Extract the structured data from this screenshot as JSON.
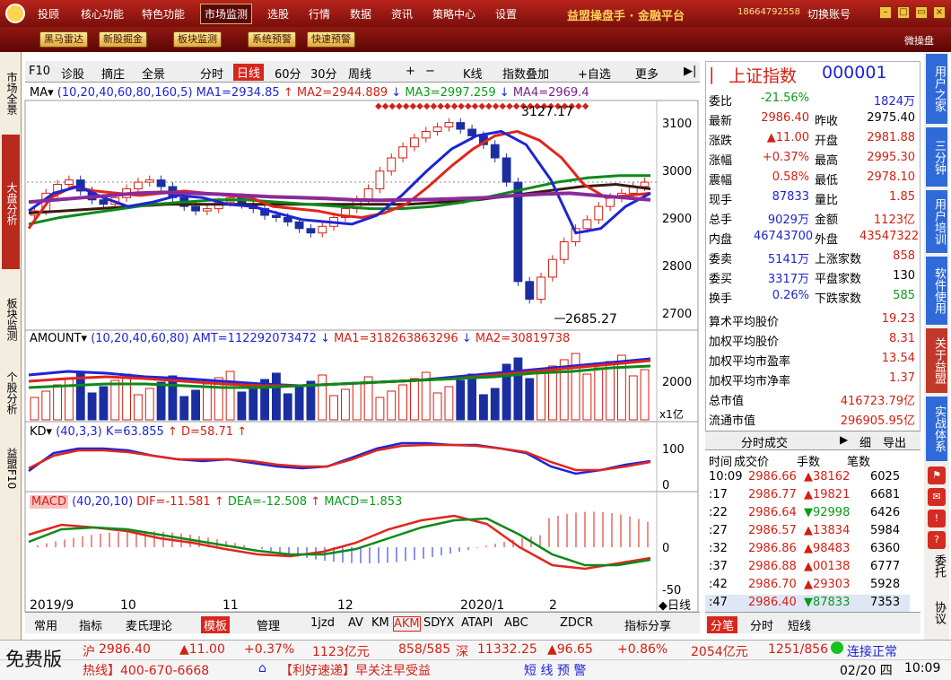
{
  "menubar": {
    "items": [
      "投顾",
      "核心功能",
      "特色功能",
      "市场监测",
      "选股",
      "行情",
      "数据",
      "资讯",
      "策略中心",
      "设置"
    ],
    "active": "市场监测",
    "brand": "益盟操盘手 · 金融平台",
    "phone": "18664792558",
    "switch_account": "切换账号"
  },
  "toolbar": {
    "buttons": [
      "黑马雷达",
      "新股掘金",
      "板块监测",
      "系统预警",
      "快速预警"
    ],
    "mini": "微操盘"
  },
  "left_tabs": [
    "市场全景",
    "大盘分析",
    "板块监测",
    "个股分析",
    "益盟F10"
  ],
  "chart_header": {
    "items": [
      "F10",
      "诊股",
      "摘庄",
      "全景",
      "分时",
      "日线",
      "60分",
      "30分",
      "周线",
      "+",
      "−",
      "K线",
      "指数叠加",
      "+自选",
      "更多"
    ],
    "selected": "日线"
  },
  "ma_legend": {
    "label": "MA",
    "params": "(10,20,40,60,80,160,5)",
    "ma1": "MA1=2934.85",
    "ma2": "MA2=2944.889",
    "ma3": "MA3=2997.259",
    "ma4": "MA4=2969.4"
  },
  "amount_legend": {
    "label": "AMOUNT",
    "params": "(10,20,40,60,80)",
    "amt": "AMT=112292073472",
    "ma1": "MA1=318263863296",
    "ma2": "MA2=30819738"
  },
  "kd_legend": {
    "label": "KD",
    "params": "(40,3,3)",
    "k": "K=63.855",
    "d": "D=58.71"
  },
  "macd_legend": {
    "label": "MACD",
    "params": "(40,20,10)",
    "dif": "DIF=-11.581",
    "dea": "DEA=-12.508",
    "macd": "MACD=1.853"
  },
  "price_axis": [
    "3100",
    "3000",
    "2900",
    "2800",
    "2700"
  ],
  "annotations": {
    "high": "3127.17",
    "low": "2685.27"
  },
  "amount_axis": [
    "2000"
  ],
  "amount_unit": "x1亿",
  "kd_axis": [
    "100",
    "50",
    "0"
  ],
  "macd_axis": [
    "0",
    "-50"
  ],
  "date_axis": [
    "2019/9",
    "10",
    "11",
    "12",
    "2020/1",
    "2"
  ],
  "date_axis_label": "◆日线",
  "quote": {
    "name": "上证指数",
    "code": "000001",
    "rows": [
      {
        "l": "委比",
        "v": "-21.56%",
        "l2": "",
        "v2": "1824万"
      },
      {
        "l": "最新",
        "v": "2986.40",
        "l2": "昨收",
        "v2": "2975.40"
      },
      {
        "l": "涨跌",
        "v": "▲11.00",
        "l2": "开盘",
        "v2": "2981.88"
      },
      {
        "l": "涨幅",
        "v": "+0.37%",
        "l2": "最高",
        "v2": "2995.30"
      },
      {
        "l": "震幅",
        "v": "0.58%",
        "l2": "最低",
        "v2": "2978.10"
      },
      {
        "l": "现手",
        "v": "87833",
        "l2": "量比",
        "v2": "1.85"
      },
      {
        "l": "总手",
        "v": "9029万",
        "l2": "金额",
        "v2": "1123亿"
      },
      {
        "l": "内盘",
        "v": "46743700",
        "l2": "外盘",
        "v2": "43547322"
      },
      {
        "l": "委卖",
        "v": "5141万",
        "l2": "上涨家数",
        "v2": "858"
      },
      {
        "l": "委买",
        "v": "3317万",
        "l2": "平盘家数",
        "v2": "130"
      },
      {
        "l": "换手",
        "v": "0.26%",
        "l2": "下跌家数",
        "v2": "585"
      }
    ],
    "stats": [
      {
        "l": "算术平均股价",
        "v": "19.23"
      },
      {
        "l": "加权平均股价",
        "v": "8.31"
      },
      {
        "l": "加权平均市盈率",
        "v": "13.54"
      },
      {
        "l": "加权平均市净率",
        "v": "1.37"
      },
      {
        "l": "总市值",
        "v": "416723.79亿"
      },
      {
        "l": "流通市值",
        "v": "296905.95亿"
      }
    ]
  },
  "ticks": {
    "title": "分时成交",
    "detail": "细",
    "export": "导出",
    "headers": [
      "时间",
      "成交价",
      "手数",
      "笔数"
    ],
    "rows": [
      [
        "10:09",
        "2986.66",
        "▲38162",
        "6025"
      ],
      [
        ":17",
        "2986.77",
        "▲19821",
        "6681"
      ],
      [
        ":22",
        "2986.64",
        "▼92998",
        "6426"
      ],
      [
        ":27",
        "2986.57",
        "▲13834",
        "5984"
      ],
      [
        ":32",
        "2986.86",
        "▲98483",
        "6360"
      ],
      [
        ":37",
        "2986.88",
        "▲00138",
        "6777"
      ],
      [
        ":42",
        "2986.70",
        "▲29303",
        "5928"
      ],
      [
        ":47",
        "2986.40",
        "▼87833",
        "7353"
      ]
    ],
    "tabs": [
      "分笔",
      "分时",
      "短线"
    ]
  },
  "right_nav": [
    "用户之家",
    "三分钟",
    "用户培训",
    "软件使用",
    "关于益盟",
    "实战体系",
    "委托",
    "协议"
  ],
  "bottom_tabs": [
    "常用",
    "指标",
    "麦氏理论",
    "模板",
    "管理",
    "1jzd",
    "AV",
    "KM",
    "AKM",
    "SDYX",
    "ATAPI",
    "ABC",
    "ZDCR",
    "指标分享"
  ],
  "status": {
    "free": "免费版",
    "sh_label": "沪",
    "sh_price": "2986.40",
    "sh_change": "▲11.00",
    "sh_pct": "+0.37%",
    "sh_amount": "1123亿元",
    "sh_updown": "858/585",
    "sz_label": "深",
    "sz_price": "11332.25",
    "sz_change": "▲96.65",
    "sz_pct": "+0.86%",
    "sz_amount": "2054亿元",
    "sz_updown": "1251/856",
    "conn": "连接正常",
    "hotline": "热线】400-670-6668",
    "news": "【利好速递】早关注早受益",
    "alert": "短 线 预 警",
    "date": "02/20 四",
    "time": "10:09"
  },
  "chart_data": {
    "type": "line",
    "categories_note": "daily candles Sep 2019 – Feb 2020",
    "price_ylim": [
      2650,
      3170
    ],
    "ma_lines": {
      "ma_red": [
        2880,
        2950,
        2975,
        2965,
        2960,
        2955,
        2960,
        2965,
        2960,
        2955,
        2950,
        2930,
        2925,
        2920,
        2910,
        2905,
        2915,
        2935,
        2975,
        3020,
        3060,
        3090,
        3100,
        3080,
        3040,
        2980,
        2950,
        2955,
        2960
      ],
      "ma_blue": [
        2920,
        2960,
        2975,
        2950,
        2930,
        2940,
        2955,
        2950,
        2935,
        2930,
        2915,
        2900,
        2895,
        2890,
        2910,
        2955,
        3010,
        3060,
        3090,
        3100,
        3070,
        2990,
        2870,
        2880,
        2930,
        2960
      ],
      "ma_green": [
        2890,
        2905,
        2915,
        2925,
        2935,
        2940,
        2945,
        2945,
        2940,
        2935,
        2930,
        2925,
        2925,
        2930,
        2940,
        2955,
        2970,
        2985,
        2995,
        3000,
        3000
      ],
      "ma_dark": [
        2915,
        2920,
        2925,
        2930,
        2935,
        2935,
        2935,
        2935,
        2935,
        2935,
        2935,
        2935,
        2940,
        2945,
        2955,
        2965,
        2975,
        2980,
        2970
      ]
    }
  }
}
